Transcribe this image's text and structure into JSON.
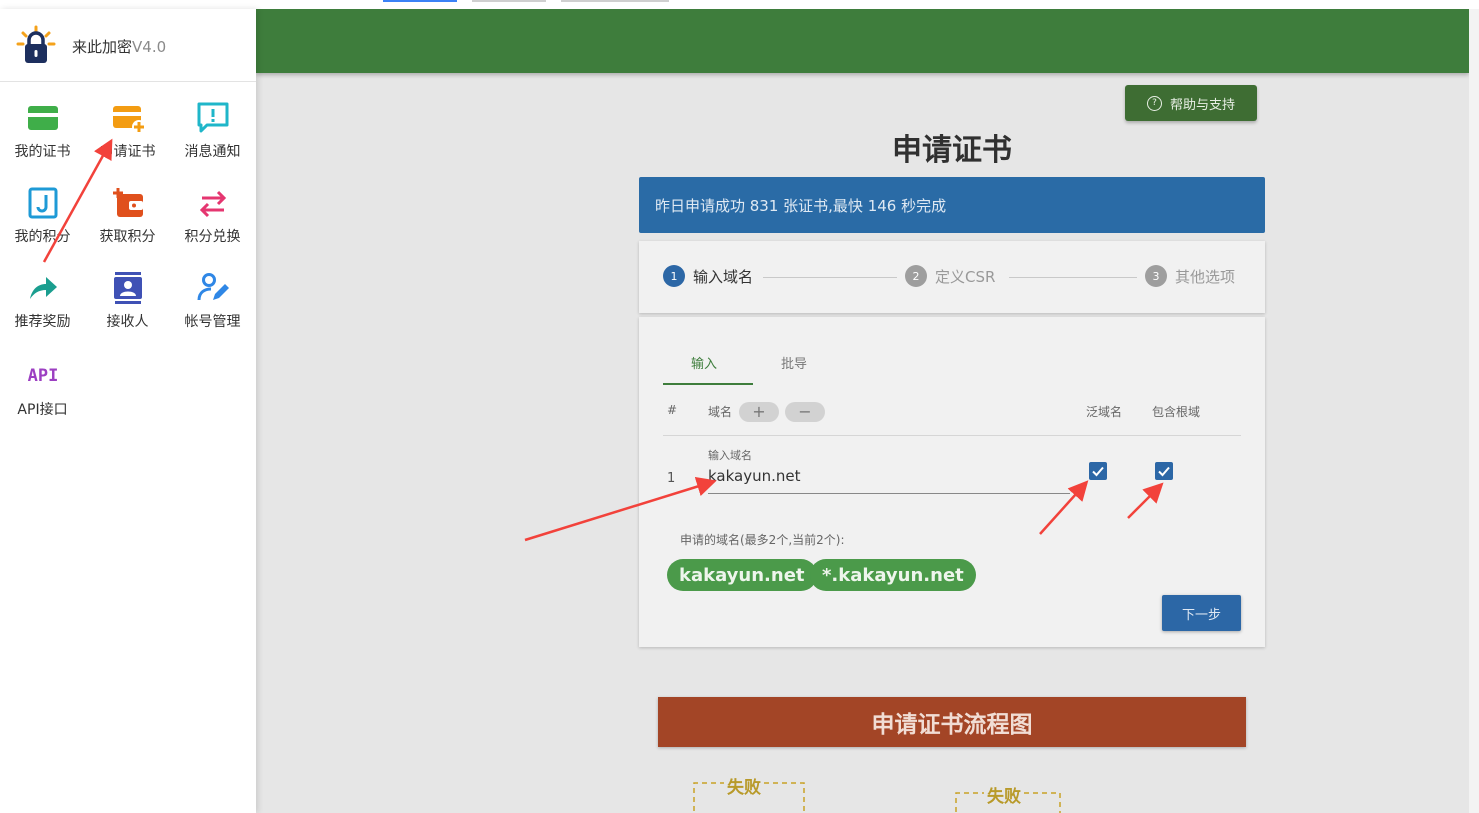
{
  "app": {
    "title": "来此加密",
    "version": "V4.0",
    "colors": {
      "header": "#3e7d3c",
      "primary": "#2c67a6",
      "chip": "#4b9a4a",
      "flow_banner": "#a34526"
    }
  },
  "sidebar": {
    "items": [
      {
        "label": "我的证书",
        "icon": "credit-card-icon",
        "color": "#3fae49"
      },
      {
        "label": "申请证书",
        "icon": "add-card-icon",
        "color": "#f39c12"
      },
      {
        "label": "消息通知",
        "icon": "message-alert-icon",
        "color": "#1fb6c9"
      },
      {
        "label": "我的积分",
        "icon": "points-j-icon",
        "color": "#1e9ad6"
      },
      {
        "label": "获取积分",
        "icon": "wallet-plus-icon",
        "color": "#e0501d"
      },
      {
        "label": "积分兑换",
        "icon": "swap-arrows-icon",
        "color": "#e53670"
      },
      {
        "label": "推荐奖励",
        "icon": "share-arrow-icon",
        "color": "#1a9e8f"
      },
      {
        "label": "接收人",
        "icon": "contact-card-icon",
        "color": "#3f51b5"
      },
      {
        "label": "帐号管理",
        "icon": "user-edit-icon",
        "color": "#2f87e6"
      },
      {
        "label": "API接口",
        "icon": "api-icon",
        "icon_text": "API",
        "color": "#9c3fc2"
      }
    ]
  },
  "header": {
    "help_button": "帮助与支持"
  },
  "main": {
    "title": "申请证书",
    "banner": "昨日申请成功 831 张证书,最快 146 秒完成",
    "steps": [
      {
        "num": "1",
        "label": "输入域名"
      },
      {
        "num": "2",
        "label": "定义CSR"
      },
      {
        "num": "3",
        "label": "其他选项"
      }
    ],
    "tabs": [
      "输入",
      "批导"
    ],
    "table": {
      "headers": {
        "index": "#",
        "domain": "域名",
        "wildcard": "泛域名",
        "root": "包含根域"
      },
      "add_symbol": "+",
      "remove_symbol": "−",
      "row": {
        "index": "1",
        "field_label": "输入域名",
        "value": "kakayun.net",
        "wildcard": true,
        "root": true
      }
    },
    "hint": "申请的域名(最多2个,当前2个):",
    "chips": [
      "kakayun.net",
      "*.kakayun.net"
    ],
    "next_button": "下一步",
    "flow_title": "申请证书流程图",
    "flow_labels": [
      "失败",
      "失败"
    ]
  }
}
